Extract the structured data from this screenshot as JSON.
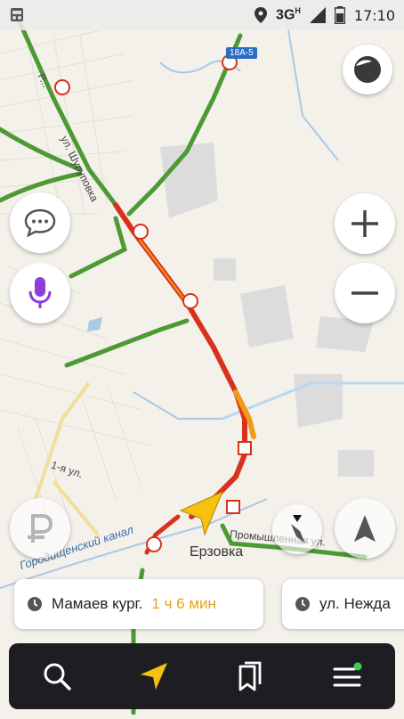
{
  "status_bar": {
    "network": "3G",
    "network_sup": "H",
    "time": "17:10"
  },
  "map": {
    "place_label": "Ерзовка",
    "road_labels": {
      "street1": "ул. Шуруповка",
      "street2": "1-я ул.",
      "street3": "Промышленная ул.",
      "street4": "Р..."
    },
    "canal_label": "Городищенский канал",
    "route_shield": "18А-5"
  },
  "route_chips": [
    {
      "destination": "Мамаев кург.",
      "duration": "1 ч 6 мин"
    },
    {
      "destination": "ул. Нежда"
    }
  ],
  "colors": {
    "traffic_green": "#4d9a34",
    "traffic_red": "#d9321c",
    "traffic_orange": "#f09a1a",
    "voice_purple": "#8b3fd6",
    "bottom_bar": "#1e1e22",
    "accent_yellow": "#f6c10f",
    "notification_green": "#39d353"
  },
  "icons": {
    "chat": "chat-bubble-icon",
    "mic": "microphone-icon",
    "parking": "parking-icon",
    "compass": "compass-icon",
    "navigate": "navigation-arrow-icon",
    "search": "search-icon",
    "bookmarks": "bookmarks-icon",
    "menu": "menu-icon"
  }
}
